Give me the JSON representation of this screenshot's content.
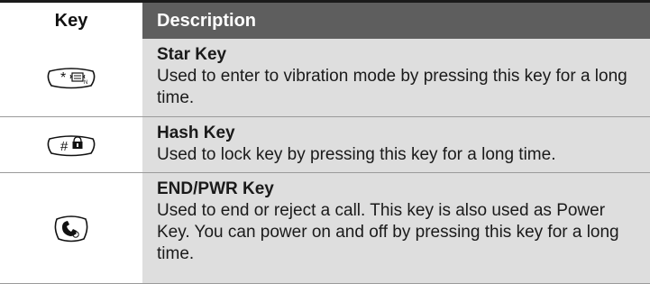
{
  "header": {
    "key": "Key",
    "description": "Description"
  },
  "rows": [
    {
      "icon": "star-vibrate-key-icon",
      "glyph": "*",
      "name": "Star Key",
      "description": "Used to enter to vibration mode by pressing this key for a long time."
    },
    {
      "icon": "hash-lock-key-icon",
      "glyph": "#",
      "name": "Hash Key",
      "description": "Used to lock key by pressing this key for a long time."
    },
    {
      "icon": "end-power-key-icon",
      "glyph": "",
      "name": "END/PWR Key",
      "description": "Used to end or reject a call. This key is also used as Power Key. You can power on and off by pressing this key for a long time."
    }
  ]
}
